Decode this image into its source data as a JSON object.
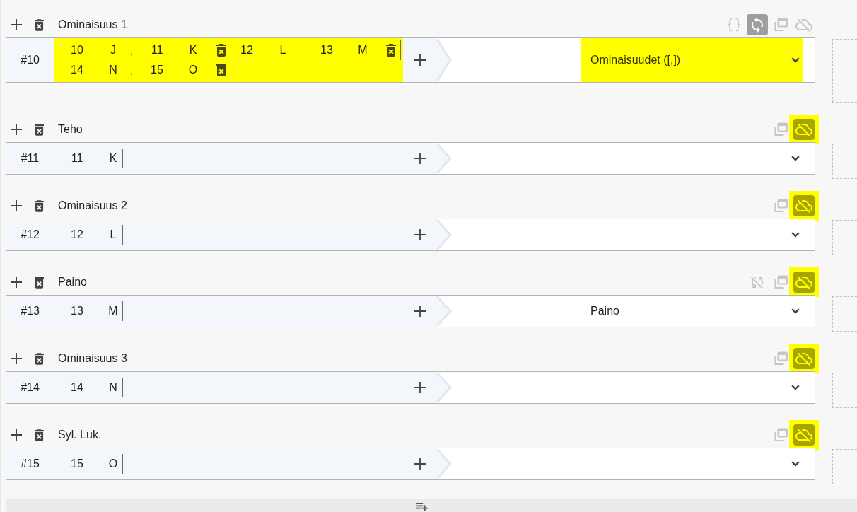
{
  "properties": [
    {
      "title": "Ominaisuus 1",
      "number": "#10",
      "toolbar": [
        {
          "kind": "braces",
          "active": false,
          "highlighted": false
        },
        {
          "kind": "sync",
          "active": true,
          "highlighted": false
        },
        {
          "kind": "copy",
          "active": false,
          "highlighted": false
        },
        {
          "kind": "cloud_off",
          "active": false,
          "highlighted": false
        }
      ],
      "mapping": {
        "highlighted": true,
        "groups": [
          {
            "tokens": [
              {
                "code": "10",
                "letter": "J"
              },
              {
                "code": "11",
                "letter": "K"
              }
            ],
            "separator": ",",
            "removable": true
          },
          {
            "tokens": [
              {
                "code": "12",
                "letter": "L"
              },
              {
                "code": "13",
                "letter": "M"
              }
            ],
            "separator": ",",
            "removable": true
          },
          {
            "tokens": [
              {
                "code": "14",
                "letter": "N"
              },
              {
                "code": "15",
                "letter": "O"
              }
            ],
            "separator": ",",
            "removable": true
          }
        ]
      },
      "select": {
        "value": "Ominaisuudet ([,])",
        "highlighted": true
      }
    },
    {
      "title": "Teho",
      "number": "#11",
      "toolbar": [
        {
          "kind": "copy",
          "active": false,
          "highlighted": false
        },
        {
          "kind": "cloud_off",
          "active": false,
          "highlighted": true
        }
      ],
      "mapping": {
        "highlighted": false,
        "groups": [
          {
            "tokens": [
              {
                "code": "11",
                "letter": "K"
              }
            ],
            "removable": false
          }
        ]
      },
      "select": {
        "highlighted": false
      }
    },
    {
      "title": "Ominaisuus 2",
      "number": "#12",
      "toolbar": [
        {
          "kind": "copy",
          "active": false,
          "highlighted": false
        },
        {
          "kind": "cloud_off",
          "active": false,
          "highlighted": true
        }
      ],
      "mapping": {
        "highlighted": false,
        "groups": [
          {
            "tokens": [
              {
                "code": "12",
                "letter": "L"
              }
            ],
            "removable": false
          }
        ]
      },
      "select": {
        "highlighted": false
      }
    },
    {
      "title": "Paino",
      "number": "#13",
      "toolbar": [
        {
          "kind": "sync_off",
          "active": false,
          "highlighted": false
        },
        {
          "kind": "copy",
          "active": false,
          "highlighted": false
        },
        {
          "kind": "cloud_off",
          "active": false,
          "highlighted": true
        }
      ],
      "mapping": {
        "highlighted": false,
        "groups": [
          {
            "tokens": [
              {
                "code": "13",
                "letter": "M"
              }
            ],
            "removable": false
          }
        ]
      },
      "select": {
        "value": "Paino",
        "highlighted": false
      }
    },
    {
      "title": "Ominaisuus 3",
      "number": "#14",
      "toolbar": [
        {
          "kind": "copy",
          "active": false,
          "highlighted": false
        },
        {
          "kind": "cloud_off",
          "active": false,
          "highlighted": true
        }
      ],
      "mapping": {
        "highlighted": false,
        "groups": [
          {
            "tokens": [
              {
                "code": "14",
                "letter": "N"
              }
            ],
            "removable": false
          }
        ]
      },
      "select": {
        "highlighted": false
      }
    },
    {
      "title": "Syl. Luk.",
      "number": "#15",
      "toolbar": [
        {
          "kind": "copy",
          "active": false,
          "highlighted": false
        },
        {
          "kind": "cloud_off",
          "active": false,
          "highlighted": true
        }
      ],
      "mapping": {
        "highlighted": false,
        "groups": [
          {
            "tokens": [
              {
                "code": "15",
                "letter": "O"
              }
            ],
            "removable": false
          }
        ]
      },
      "select": {
        "highlighted": false
      }
    }
  ]
}
